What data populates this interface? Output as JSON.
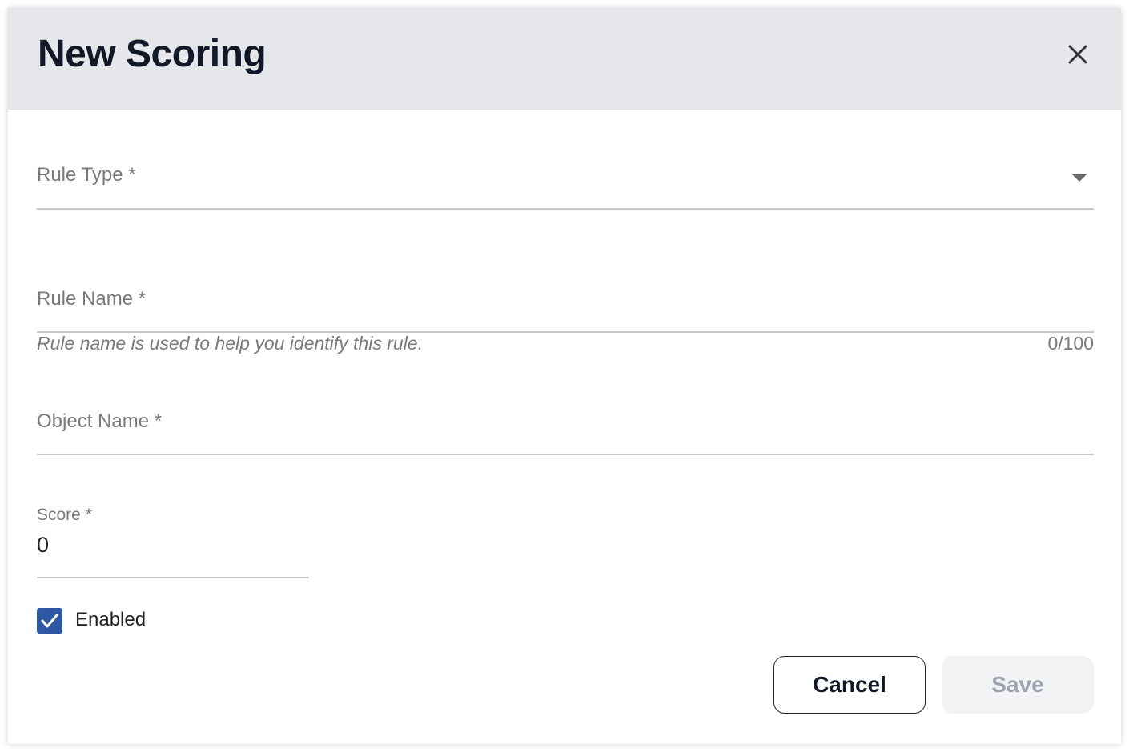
{
  "dialog": {
    "title": "New Scoring"
  },
  "fields": {
    "rule_type": {
      "label": "Rule Type *"
    },
    "rule_name": {
      "label": "Rule Name *",
      "hint": "Rule name is used to help you identify this rule.",
      "counter": "0/100"
    },
    "object_name": {
      "label": "Object Name *"
    },
    "score": {
      "label": "Score *",
      "value": "0"
    }
  },
  "enabled": {
    "label": "Enabled",
    "checked": true
  },
  "actions": {
    "cancel_label": "Cancel",
    "save_label": "Save"
  },
  "icons": {
    "close": "close-icon",
    "dropdown": "chevron-down-icon",
    "check": "check-icon"
  },
  "colors": {
    "header_bg": "#e6e7eb",
    "checkbox_accent": "#2f58a4",
    "disabled_button_bg": "#f2f3f5"
  }
}
